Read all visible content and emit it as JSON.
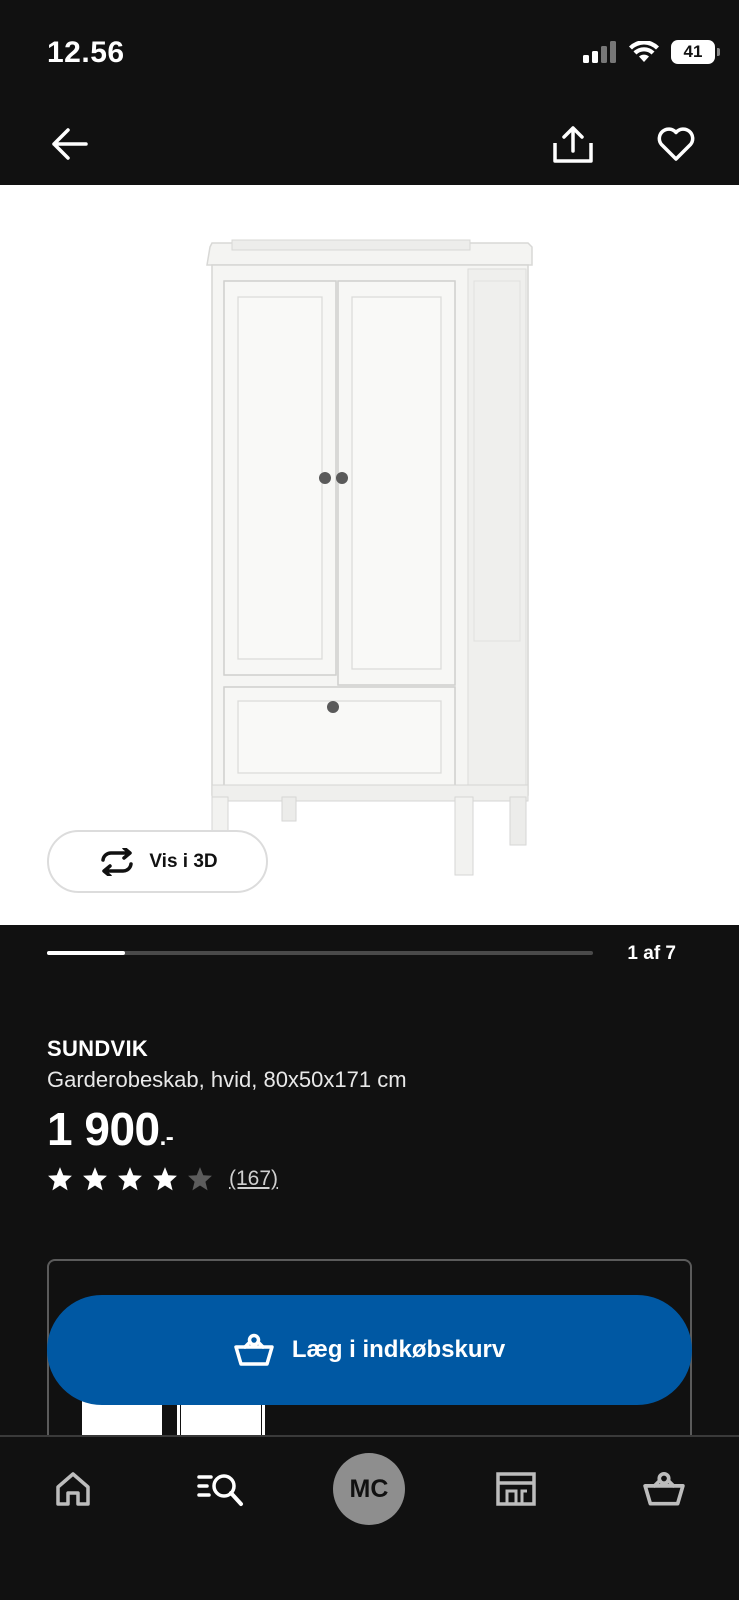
{
  "status": {
    "time": "12.56",
    "battery": "41"
  },
  "nav": {
    "back_icon": "arrow-left-icon",
    "share_icon": "share-icon",
    "favorite_icon": "heart-icon"
  },
  "gallery": {
    "view3d_label": "Vis i 3D",
    "page_counter": "1 af 7",
    "progress_fraction": 0.143
  },
  "product": {
    "name": "SUNDVIK",
    "description": "Garderobeskab, hvid, 80x50x171 cm",
    "price_main": "1 900",
    "price_suffix": ".-",
    "rating": 4,
    "rating_max": 5,
    "review_count": "(167)"
  },
  "cart": {
    "button_label": "Læg i indkøbskurv"
  },
  "bottom_nav": {
    "tabs": [
      {
        "id": "home",
        "icon": "home-icon"
      },
      {
        "id": "search",
        "icon": "search-list-icon"
      },
      {
        "id": "profile",
        "label": "MC"
      },
      {
        "id": "store",
        "icon": "store-icon"
      },
      {
        "id": "basket",
        "icon": "basket-icon"
      }
    ]
  },
  "colors": {
    "background": "#111111",
    "accent_blue": "#0058a3",
    "white": "#ffffff"
  }
}
